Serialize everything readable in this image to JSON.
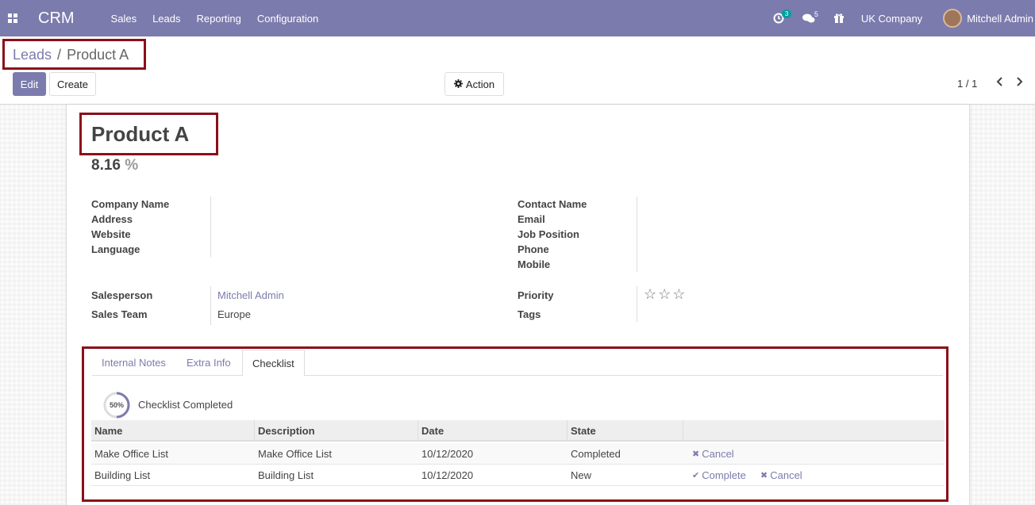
{
  "navbar": {
    "brand": "CRM",
    "menu": [
      "Sales",
      "Leads",
      "Reporting",
      "Configuration"
    ],
    "activity_count": "3",
    "messages_count": "5",
    "company": "UK Company",
    "user": "Mitchell Admin",
    "accent": "#7c7bad"
  },
  "breadcrumb": {
    "parent": "Leads",
    "separator": "/",
    "current": "Product A"
  },
  "toolbar": {
    "edit_label": "Edit",
    "create_label": "Create",
    "action_label": "Action",
    "pager": "1 / 1"
  },
  "record": {
    "title": "Product A",
    "probability": "8.16",
    "probability_unit": "%"
  },
  "fields_left": {
    "company_name": "Company Name",
    "address": "Address",
    "website": "Website",
    "language": "Language",
    "salesperson_label": "Salesperson",
    "salesperson_value": "Mitchell Admin",
    "sales_team_label": "Sales Team",
    "sales_team_value": "Europe"
  },
  "fields_right": {
    "contact_name": "Contact Name",
    "email": "Email",
    "job_position": "Job Position",
    "phone": "Phone",
    "mobile": "Mobile",
    "priority_label": "Priority",
    "priority_stars": "☆☆☆",
    "tags_label": "Tags"
  },
  "notebook": {
    "tabs": [
      "Internal Notes",
      "Extra Info",
      "Checklist"
    ],
    "active_tab": "Checklist",
    "progress_text": "50%",
    "progress_value": 0.5,
    "progress_label": "Checklist Completed"
  },
  "checklist": {
    "columns": [
      "Name",
      "Description",
      "Date",
      "State"
    ],
    "rows": [
      {
        "name": "Make Office List",
        "description": "Make Office List",
        "date": "10/12/2020",
        "state": "Completed",
        "actions": [
          "Cancel"
        ]
      },
      {
        "name": "Building List",
        "description": "Building List",
        "date": "10/12/2020",
        "state": "New",
        "actions": [
          "Complete",
          "Cancel"
        ]
      }
    ]
  }
}
